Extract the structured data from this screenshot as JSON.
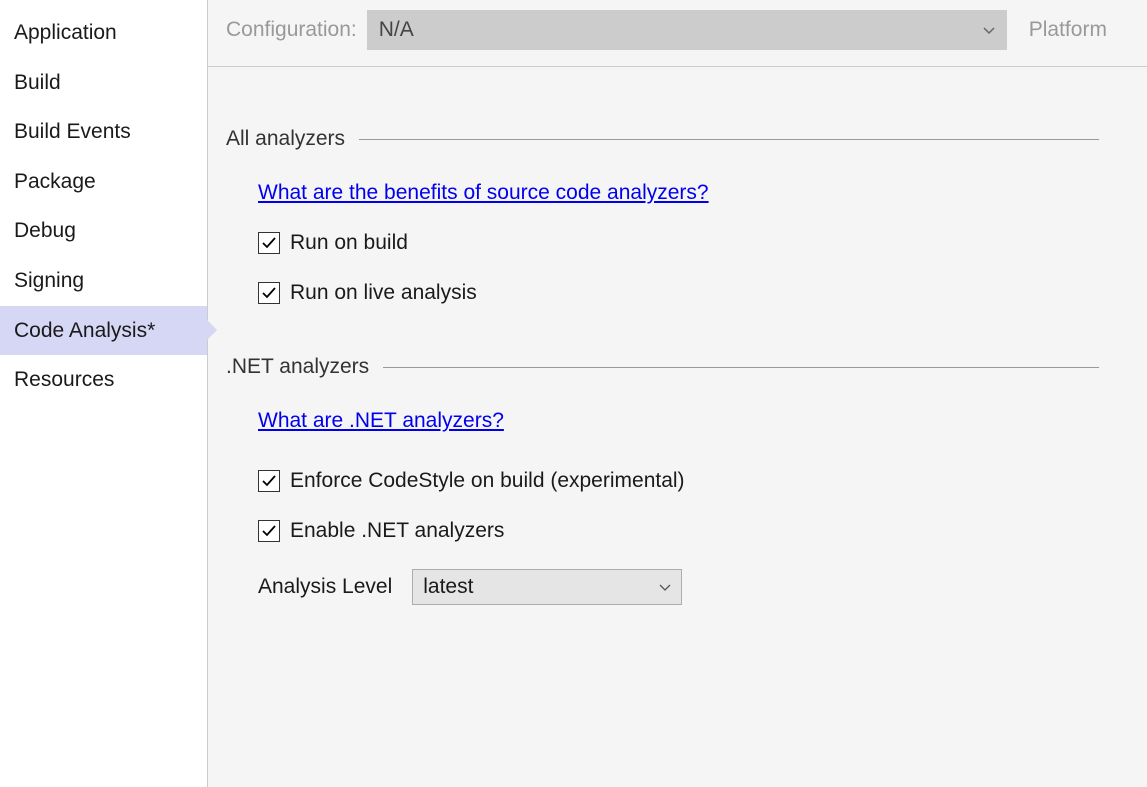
{
  "sidebar": {
    "items": [
      {
        "label": "Application"
      },
      {
        "label": "Build"
      },
      {
        "label": "Build Events"
      },
      {
        "label": "Package"
      },
      {
        "label": "Debug"
      },
      {
        "label": "Signing"
      },
      {
        "label": "Code Analysis*"
      },
      {
        "label": "Resources"
      }
    ],
    "selected_index": 6
  },
  "config_bar": {
    "configuration_label": "Configuration:",
    "configuration_value": "N/A",
    "platform_label": "Platform"
  },
  "sections": {
    "all_analyzers": {
      "title": "All analyzers",
      "link": "What are the benefits of source code analyzers?",
      "run_on_build": {
        "label": "Run on build",
        "checked": true
      },
      "run_on_live": {
        "label": "Run on live analysis",
        "checked": true
      }
    },
    "net_analyzers": {
      "title": ".NET analyzers",
      "link": "What are .NET analyzers?",
      "enforce_codestyle": {
        "label": "Enforce CodeStyle on build (experimental)",
        "checked": true
      },
      "enable_net": {
        "label": "Enable .NET analyzers",
        "checked": true
      },
      "analysis_level": {
        "label": "Analysis Level",
        "value": "latest"
      }
    }
  }
}
